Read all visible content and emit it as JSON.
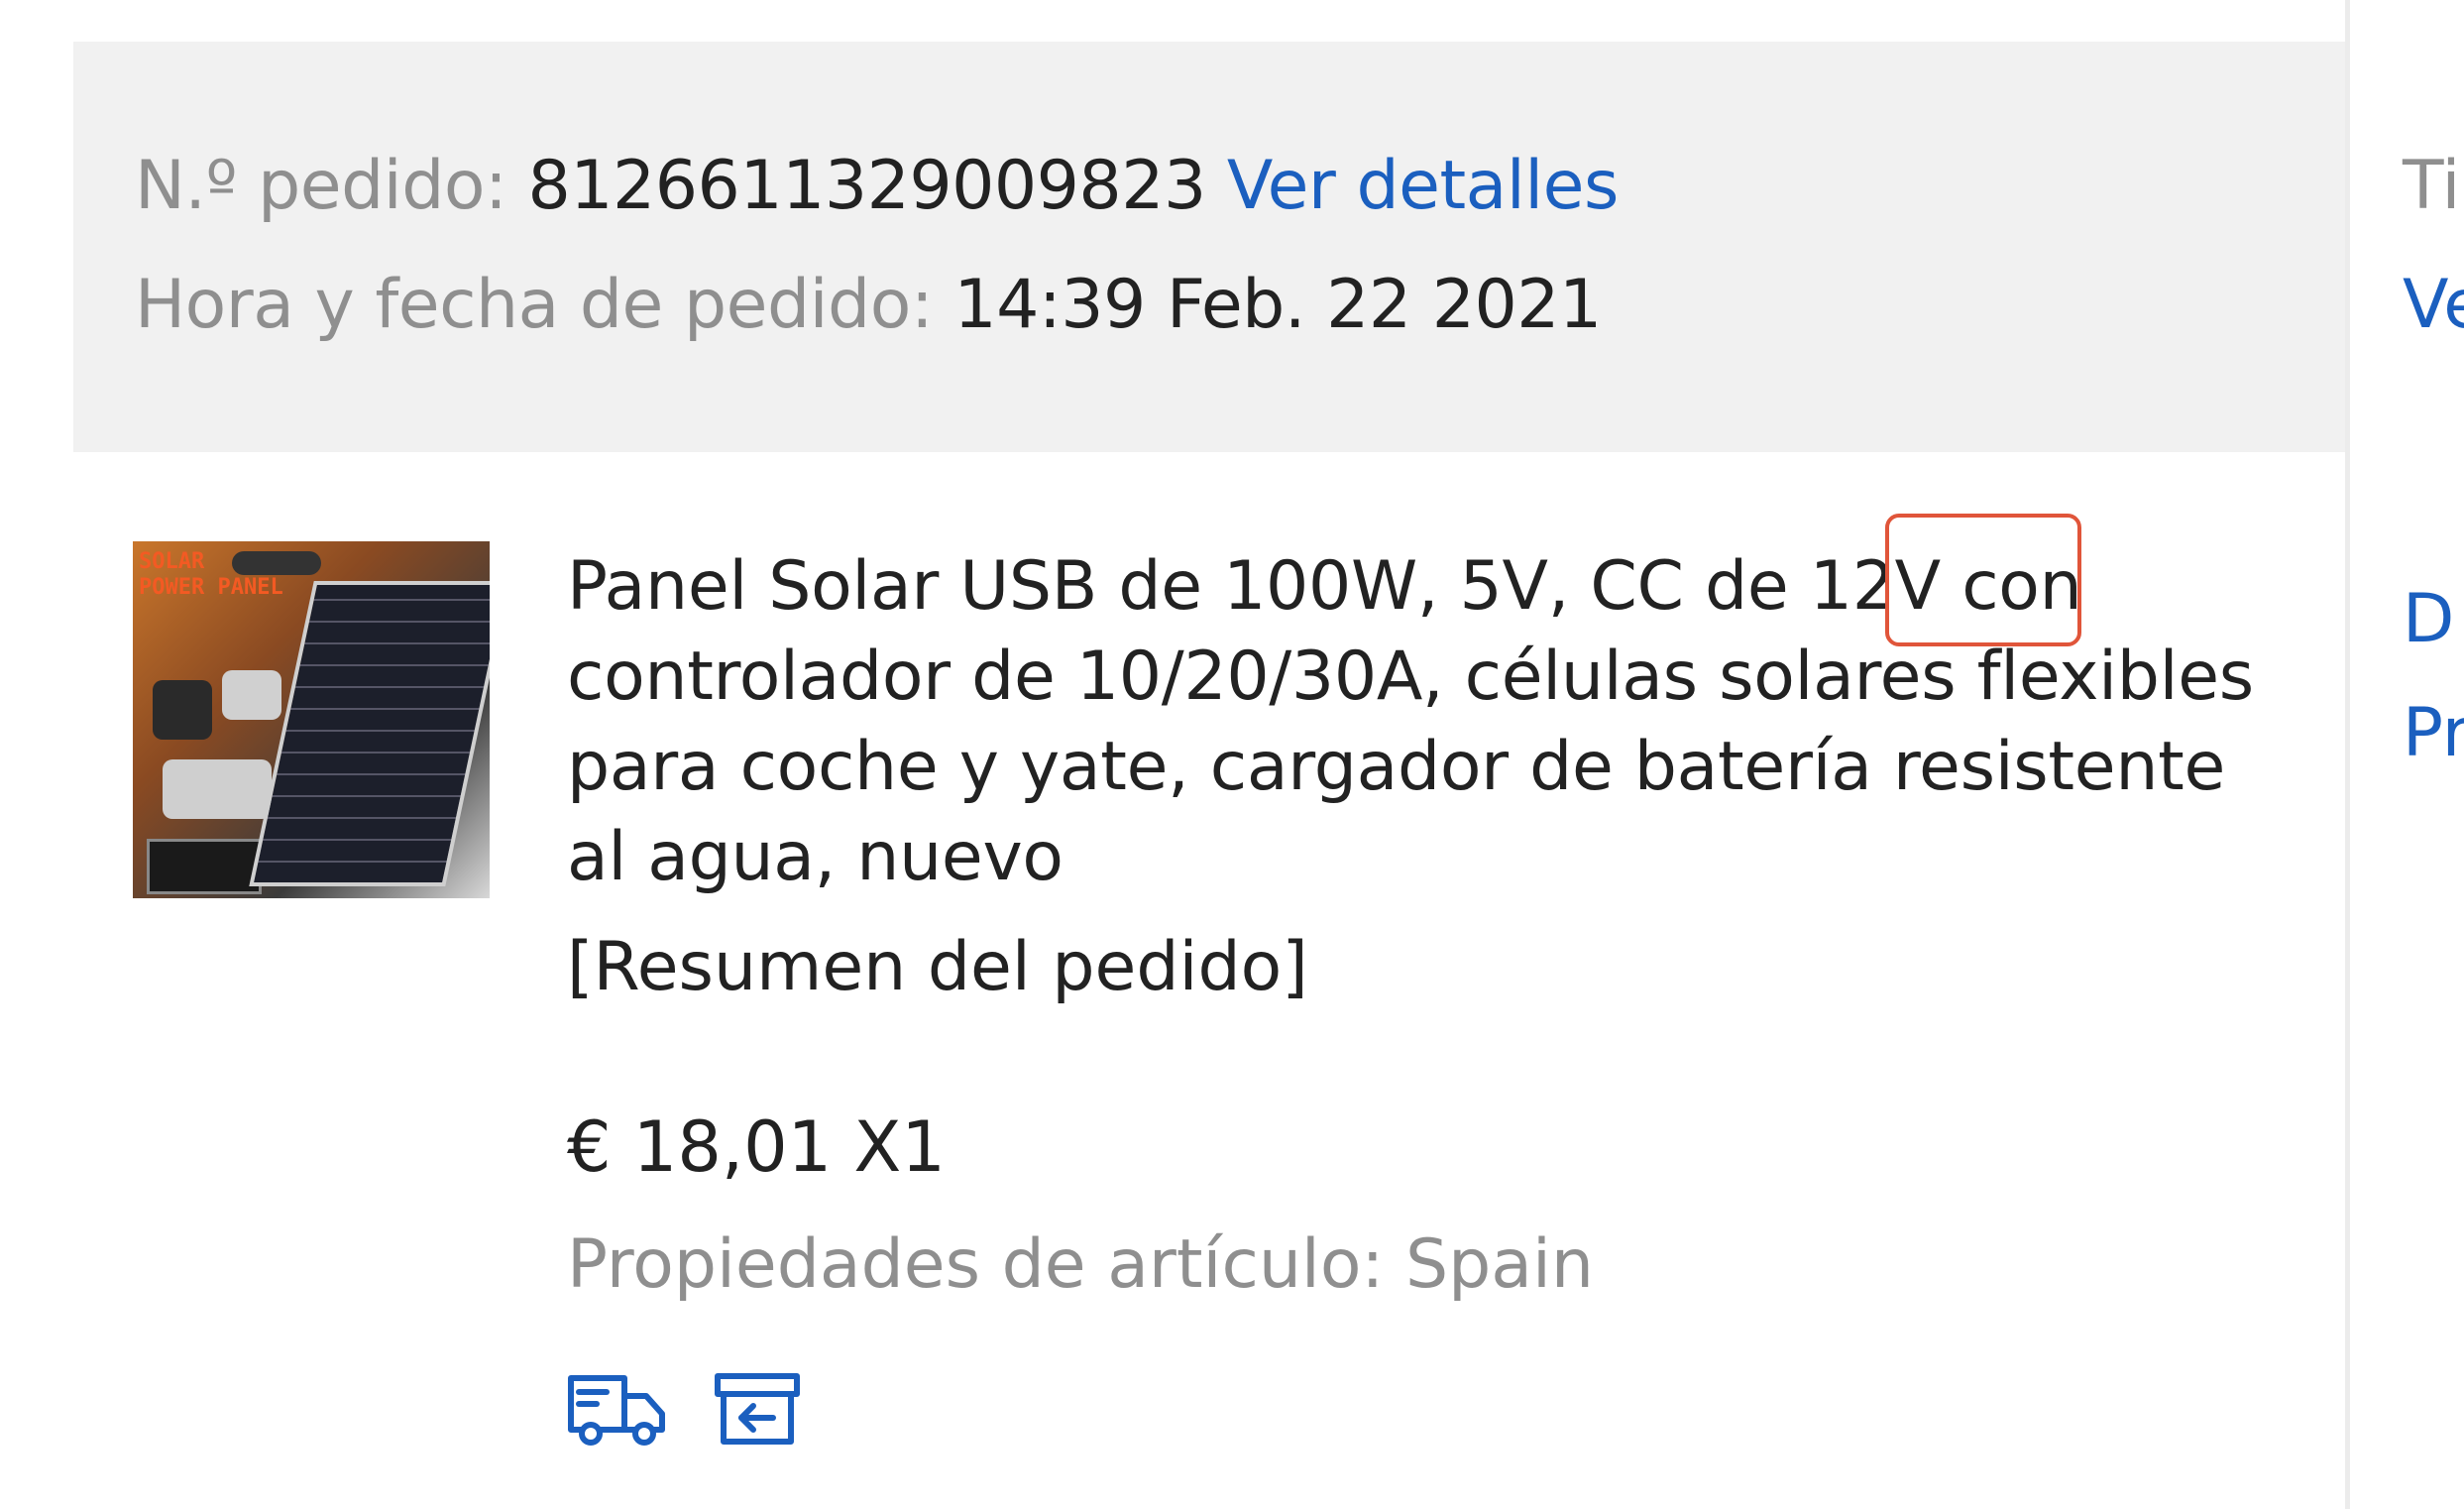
{
  "order": {
    "number_label": "N.º pedido:",
    "number_value": "8126611329009823",
    "details_link": "Ver detalles",
    "datetime_label": "Hora y fecha de pedido:",
    "datetime_value": "14:39 Feb. 22 2021"
  },
  "right_column": {
    "partial_1": "Ti",
    "partial_2": "Ve",
    "partial_3": "D",
    "partial_4": "Pr"
  },
  "product": {
    "image_alt": "SOLAR POWER PANEL",
    "title": "Panel Solar USB de 100W, 5V, CC de 12V con controlador de 10/20/30A, células solares flexibles para coche y yate, cargador de batería resistente al agua, nuevo",
    "summary": "[Resumen del pedido]",
    "price": "€ 18,01 X1",
    "properties": "Propiedades de artículo: Spain"
  },
  "icons": {
    "tracking": "truck-icon",
    "return": "return-box-icon"
  },
  "colors": {
    "header_bg": "#f1f1f1",
    "link": "#1b5fbf",
    "muted_text": "#8f8f8f",
    "primary_text": "#222222",
    "highlight": "#e0553a"
  }
}
